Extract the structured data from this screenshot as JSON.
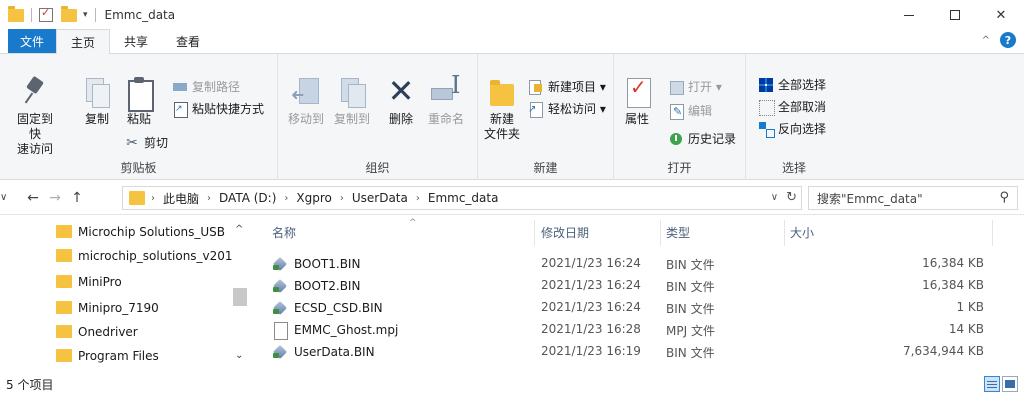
{
  "window": {
    "title": "Emmc_data",
    "minimize_icon": "minimize-icon",
    "maximize_icon": "maximize-icon",
    "close_glyph": "✕"
  },
  "ribbon_tabs": [
    {
      "label": "文件"
    },
    {
      "label": "主页"
    },
    {
      "label": "共享"
    },
    {
      "label": "查看"
    }
  ],
  "ribbon": {
    "help_glyph": "?",
    "collapse_glyph": "^",
    "clipboard": {
      "pin_label_1": "固定到快",
      "pin_label_2": "速访问",
      "copy_label": "复制",
      "paste_label": "粘贴",
      "copy_path_label": "复制路径",
      "paste_shortcut_label": "粘贴快捷方式",
      "cut_label": "剪切",
      "group_label": "剪贴板"
    },
    "organize": {
      "move_to_label": "移动到",
      "copy_to_label": "复制到",
      "delete_label": "删除",
      "rename_label": "重命名",
      "group_label": "组织"
    },
    "new": {
      "new_folder_label_1": "新建",
      "new_folder_label_2": "文件夹",
      "new_item_label": "新建项目 ▾",
      "easy_access_label": "轻松访问 ▾",
      "group_label": "新建"
    },
    "open": {
      "properties_label": "属性",
      "open_label": "打开 ▾",
      "edit_label": "编辑",
      "history_label": "历史记录",
      "group_label": "打开"
    },
    "select": {
      "select_all_label": "全部选择",
      "select_none_label": "全部取消",
      "invert_label": "反向选择",
      "group_label": "选择"
    }
  },
  "address_bar": {
    "back_glyph": "←",
    "forward_glyph": "→",
    "recent_glyph": "∨",
    "up_glyph": "↑",
    "breadcrumbs": [
      "此电脑",
      "DATA (D:)",
      "Xgpro",
      "UserData",
      "Emmc_data"
    ],
    "chevron_glyph": "›",
    "dropdown_glyph": "∨",
    "refresh_glyph": "↻",
    "search_placeholder": "搜索\"Emmc_data\"",
    "search_icon": "search-icon"
  },
  "nav_pane": {
    "items": [
      {
        "label": "Microchip Solutions_USB"
      },
      {
        "label": "microchip_solutions_v201"
      },
      {
        "label": "MiniPro"
      },
      {
        "label": "Minipro_7190"
      },
      {
        "label": "Onedriver"
      },
      {
        "label": "Program Files"
      }
    ],
    "scroll_up_glyph": "^",
    "scroll_down_glyph": "⌄"
  },
  "file_list": {
    "columns": {
      "name": "名称",
      "date": "修改日期",
      "type": "类型",
      "size": "大小"
    },
    "sort_glyph": "^",
    "rows": [
      {
        "name": "BOOT1.BIN",
        "date": "2021/1/23 16:24",
        "type": "BIN 文件",
        "size": "16,384 KB",
        "icon": "bin-file-icon"
      },
      {
        "name": "BOOT2.BIN",
        "date": "2021/1/23 16:24",
        "type": "BIN 文件",
        "size": "16,384 KB",
        "icon": "bin-file-icon"
      },
      {
        "name": "ECSD_CSD.BIN",
        "date": "2021/1/23 16:24",
        "type": "BIN 文件",
        "size": "1 KB",
        "icon": "bin-file-icon"
      },
      {
        "name": "EMMC_Ghost.mpj",
        "date": "2021/1/23 16:28",
        "type": "MPJ 文件",
        "size": "14 KB",
        "icon": "document-icon"
      },
      {
        "name": "UserData.BIN",
        "date": "2021/1/23 16:19",
        "type": "BIN 文件",
        "size": "7,634,944 KB",
        "icon": "bin-file-icon"
      }
    ]
  },
  "status_bar": {
    "item_count": "5 个项目"
  },
  "colors": {
    "accent": "#1979ca",
    "folder": "#f5c242",
    "ribbon_bg": "#f5f6f7"
  }
}
